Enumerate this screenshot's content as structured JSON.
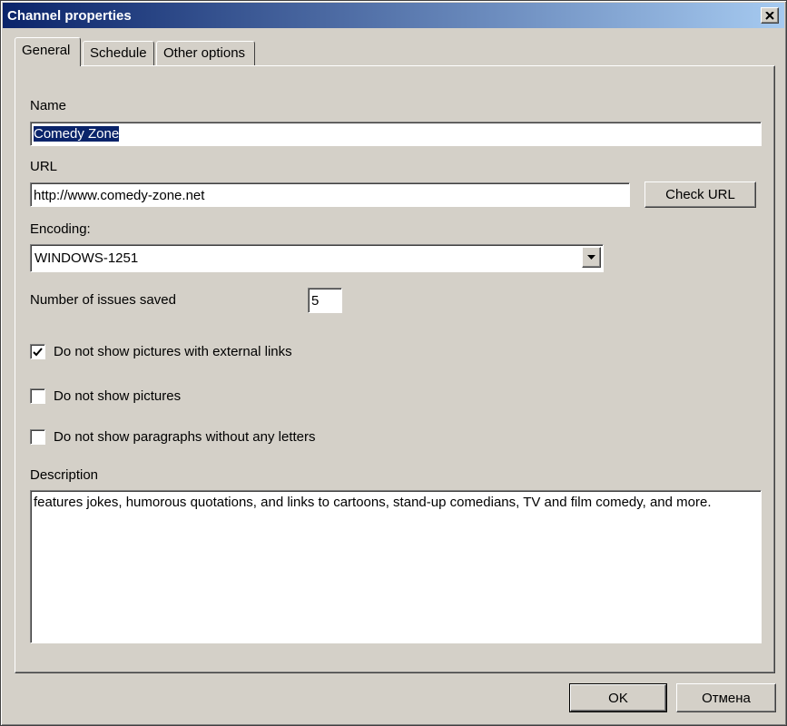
{
  "window": {
    "title": "Channel properties"
  },
  "tabs": [
    {
      "label": "General",
      "active": true
    },
    {
      "label": "Schedule",
      "active": false
    },
    {
      "label": "Other options",
      "active": false
    }
  ],
  "form": {
    "name_label": "Name",
    "name_value": "Comedy Zone",
    "url_label": "URL",
    "url_value": "http://www.comedy-zone.net",
    "check_url_label": "Check URL",
    "encoding_label": "Encoding:",
    "encoding_value": "WINDOWS-1251",
    "issues_label": "Number of issues saved",
    "issues_value": "5",
    "checkboxes": [
      {
        "label": "Do not show pictures with external links",
        "checked": true
      },
      {
        "label": "Do not show pictures",
        "checked": false
      },
      {
        "label": "Do not show paragraphs without any letters",
        "checked": false
      }
    ],
    "description_label": "Description",
    "description_value": "features jokes, humorous quotations, and links to cartoons, stand-up comedians, TV and film comedy, and more."
  },
  "buttons": {
    "ok": "OK",
    "cancel": "Отмена"
  },
  "icons": {
    "close": "close-icon",
    "dropdown": "dropdown-arrow-icon",
    "check": "checkmark-icon"
  },
  "colors": {
    "titlebar_start": "#0a246a",
    "titlebar_end": "#a6caf0",
    "face": "#d4d0c8",
    "selection": "#0a246a"
  }
}
